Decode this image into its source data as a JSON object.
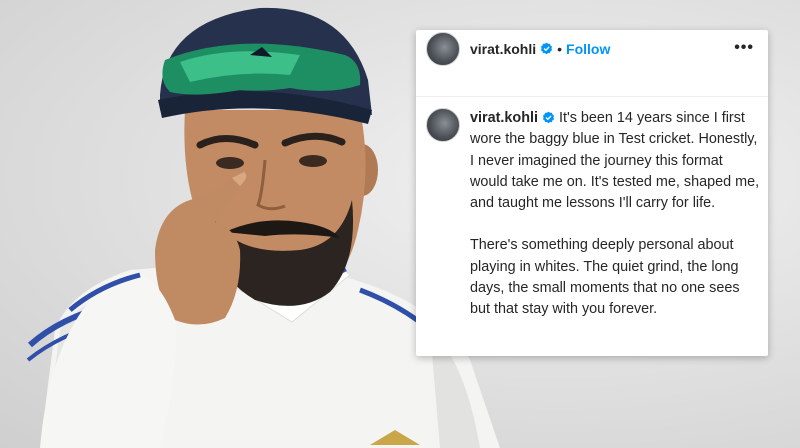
{
  "post": {
    "username": "virat.kohli",
    "follow_label": "Follow",
    "dot": "•",
    "more_label": "•••",
    "caption_para1": "It's been 14 years since I first wore the baggy blue in Test cricket. Honestly, I never imagined the journey this format would take me on. It's tested me, shaped me, and taught me lessons I'll carry for life.",
    "caption_para2": "There's something deeply personal about playing in whites. The quiet grind, the long days, the small moments that no one sees but that stay with you forever."
  },
  "colors": {
    "follow": "#0095f6",
    "verified": "#0095f6",
    "text": "#262626"
  },
  "icons": [
    "verified-badge-icon",
    "more-options-icon"
  ]
}
